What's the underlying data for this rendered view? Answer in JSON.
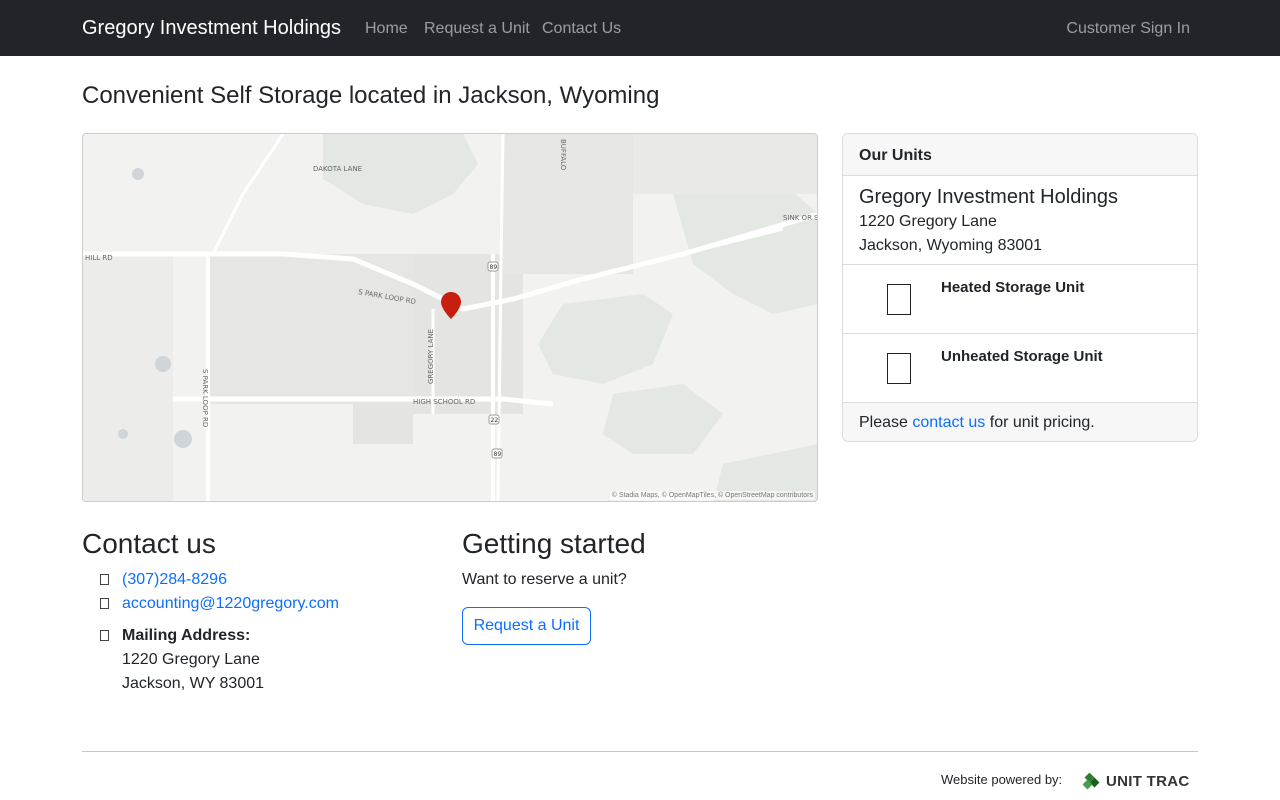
{
  "navbar": {
    "brand": "Gregory Investment Holdings",
    "links": [
      {
        "label": "Home"
      },
      {
        "label": "Request a Unit"
      },
      {
        "label": "Contact Us"
      }
    ],
    "sign_in": "Customer Sign In"
  },
  "page_title": "Convenient Self Storage located in Jackson, Wyoming",
  "map": {
    "street_labels": [
      "DAKOTA LANE",
      "S PARK LOOP RD",
      "GREGORY LANE",
      "HIGH SCHOOL RD",
      "S PARK LOOP RD",
      "HILL RD",
      "BUFFALO",
      "SINK OR SWIM"
    ],
    "route_shields": [
      "89",
      "22",
      "89"
    ],
    "attribution": "© Stadia Maps, © OpenMapTiles, © OpenStreetMap contributors",
    "marker": "location-pin"
  },
  "units_card": {
    "header": "Our Units",
    "facility_name": "Gregory Investment Holdings",
    "address_line1": "1220 Gregory Lane",
    "address_line2": "Jackson, Wyoming 83001",
    "units": [
      {
        "name": "Heated Storage Unit"
      },
      {
        "name": "Unheated Storage Unit"
      }
    ],
    "footer_prefix": "Please",
    "footer_link": "contact us",
    "footer_suffix": "for unit pricing."
  },
  "contact": {
    "title": "Contact us",
    "phone": "(307)284-8296",
    "email": "accounting@1220gregory.com",
    "mailing_label": "Mailing Address:",
    "mailing_line1": "1220 Gregory Lane",
    "mailing_line2": "Jackson, WY 83001"
  },
  "getting_started": {
    "title": "Getting started",
    "text": "Want to reserve a unit?",
    "button": "Request a Unit"
  },
  "footer": {
    "powered_by": "Website powered by:",
    "logo_text": "UNIT TRAC"
  },
  "colors": {
    "navbar_bg": "#212529",
    "link_blue": "#0d6efd",
    "marker_red": "#c81e0f",
    "logo_green": "#2e7d32"
  }
}
